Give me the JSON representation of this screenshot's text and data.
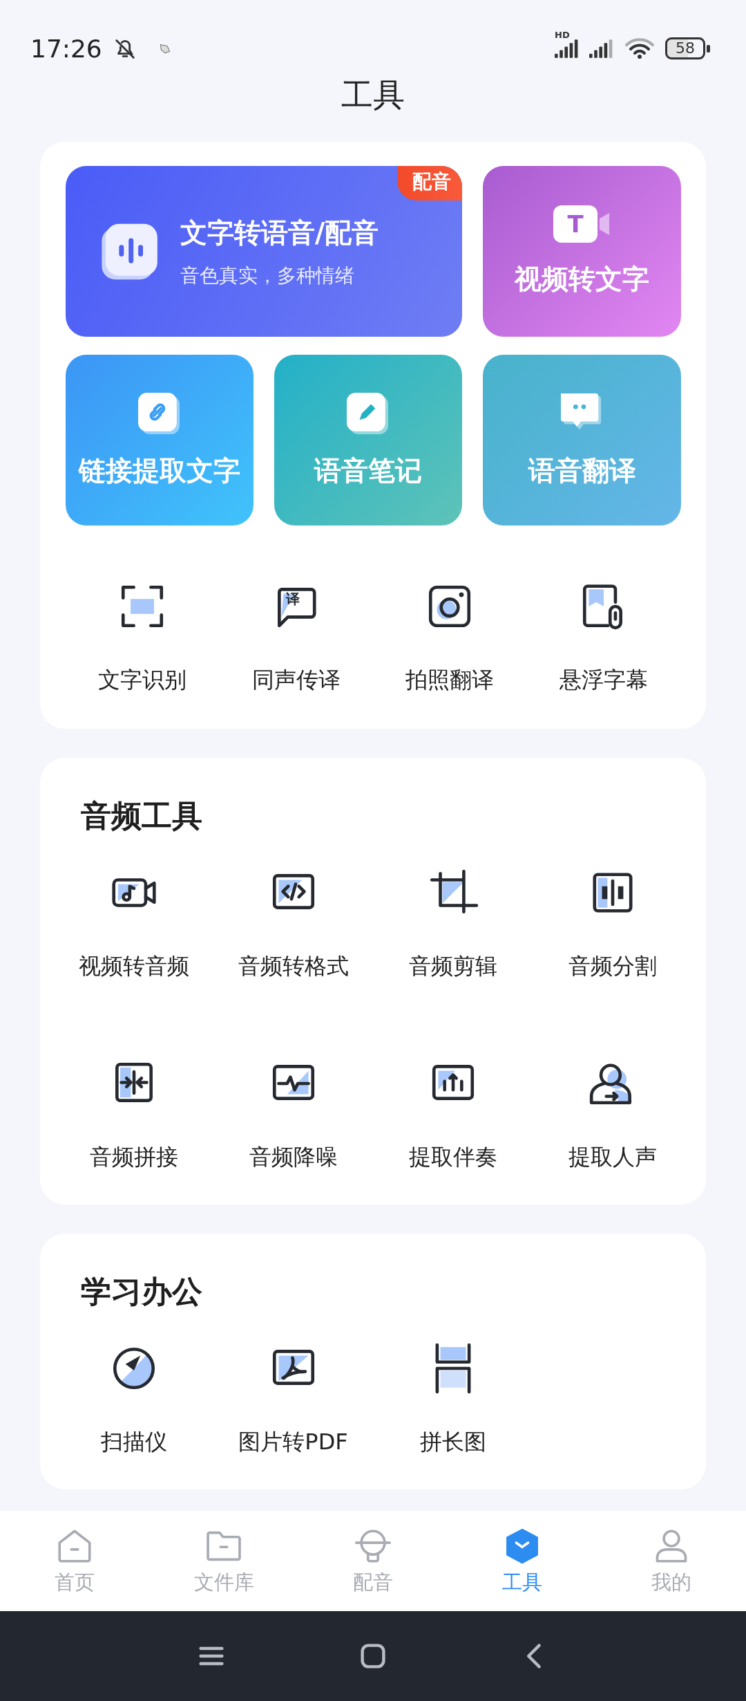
{
  "status_bar": {
    "time": "17:26",
    "network": "HD",
    "battery": "58"
  },
  "title": "工具",
  "features": [
    {
      "kind": "wide",
      "title": "文字转语音/配音",
      "subtitle": "音色真实，多种情绪",
      "badge": "配音"
    },
    {
      "kind": "tile",
      "title": "视频转文字",
      "icon_text": "T"
    },
    {
      "kind": "tile",
      "title": "链接提取文字"
    },
    {
      "kind": "tile",
      "title": "语音笔记"
    },
    {
      "kind": "tile",
      "title": "语音翻译"
    }
  ],
  "quick_tools": [
    {
      "label": "文字识别"
    },
    {
      "label": "同声传译",
      "icon_text": "译"
    },
    {
      "label": "拍照翻译"
    },
    {
      "label": "悬浮字幕"
    }
  ],
  "sections": [
    {
      "title": "音频工具",
      "tools": [
        {
          "label": "视频转音频"
        },
        {
          "label": "音频转格式"
        },
        {
          "label": "音频剪辑"
        },
        {
          "label": "音频分割"
        },
        {
          "label": "音频拼接"
        },
        {
          "label": "音频降噪"
        },
        {
          "label": "提取伴奏"
        },
        {
          "label": "提取人声"
        }
      ]
    },
    {
      "title": "学习办公",
      "tools": [
        {
          "label": "扫描仪"
        },
        {
          "label": "图片转PDF"
        },
        {
          "label": "拼长图"
        }
      ]
    }
  ],
  "tabs": [
    {
      "label": "首页",
      "selected": false
    },
    {
      "label": "文件库",
      "selected": false
    },
    {
      "label": "配音",
      "selected": false
    },
    {
      "label": "工具",
      "selected": true
    },
    {
      "label": "我的",
      "selected": false
    }
  ]
}
